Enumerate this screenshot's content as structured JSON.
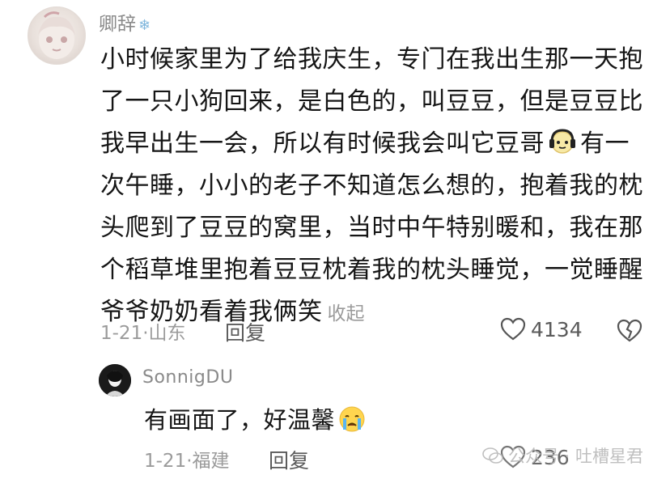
{
  "main_comment": {
    "username": "卿辞",
    "username_badge_icon": "snowflake-icon",
    "text_lines": [
      "小时候家里为了给我庆生，专门在我出生那一天抱",
      "了一只小狗回来，是白色的，叫豆豆，但是豆豆比",
      "我早出生一会，所以有时候我会叫它豆哥",
      "有一",
      "次午睡，小小的老子不知道怎么想的，抱着我的枕",
      "头爬到了豆豆的窝里，当时中午特别暖和，我在那",
      "个稻草堆里抱着豆豆枕着我的枕头睡觉，一觉睡醒",
      "爷爷奶奶看着我俩笑"
    ],
    "inline_emoji": "headphones-face-emoji",
    "collapse_label": "收起",
    "date": "1-21·",
    "location": "山东",
    "reply_label": "回复",
    "like_count": "4134"
  },
  "reply": {
    "username": "SonnigDU",
    "text": "有画面了，好温馨",
    "emoji": "crying-face-emoji",
    "date": "1-21·",
    "location": "福建",
    "reply_label": "回复",
    "like_count": "236"
  },
  "watermark": {
    "text": "公众号 · 吐槽星君"
  }
}
